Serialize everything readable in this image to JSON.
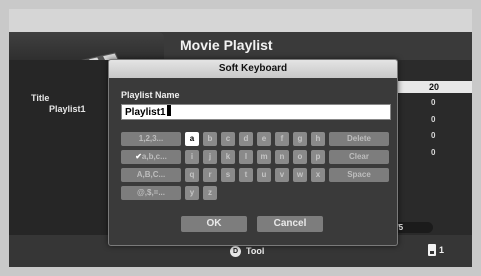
{
  "screen": {
    "title": "Movie Playlist",
    "meta_title_label": "Title",
    "meta_title_value": "Playlist1",
    "list_header_value": "20",
    "counts": [
      "0",
      "0",
      "0",
      "0"
    ],
    "page_indicator": "1/5"
  },
  "footer": {
    "tool_button_glyph": "D",
    "tool_label": "Tool",
    "device_number": "1"
  },
  "dialog": {
    "title": "Soft Keyboard",
    "field_label": "Playlist Name",
    "field_value": "Playlist1",
    "modes": [
      "1,2,3...",
      "a,b,c...",
      "A,B,C...",
      "@,$,=..."
    ],
    "active_mode_check": "✔",
    "rows": [
      [
        "a",
        "b",
        "c",
        "d",
        "e",
        "f",
        "g",
        "h"
      ],
      [
        "i",
        "j",
        "k",
        "l",
        "m",
        "n",
        "o",
        "p"
      ],
      [
        "q",
        "r",
        "s",
        "t",
        "u",
        "v",
        "w",
        "x"
      ],
      [
        "y",
        "z"
      ]
    ],
    "selected_key": "a",
    "actions": [
      "Delete",
      "Clear",
      "Space"
    ],
    "ok_label": "OK",
    "cancel_label": "Cancel"
  },
  "colors": {
    "background": "#3a3a3a",
    "dialog_title_bg": "#d6d6d6",
    "selected_key_bg": "#ffffff",
    "key_bg": "#8a8a8a"
  }
}
